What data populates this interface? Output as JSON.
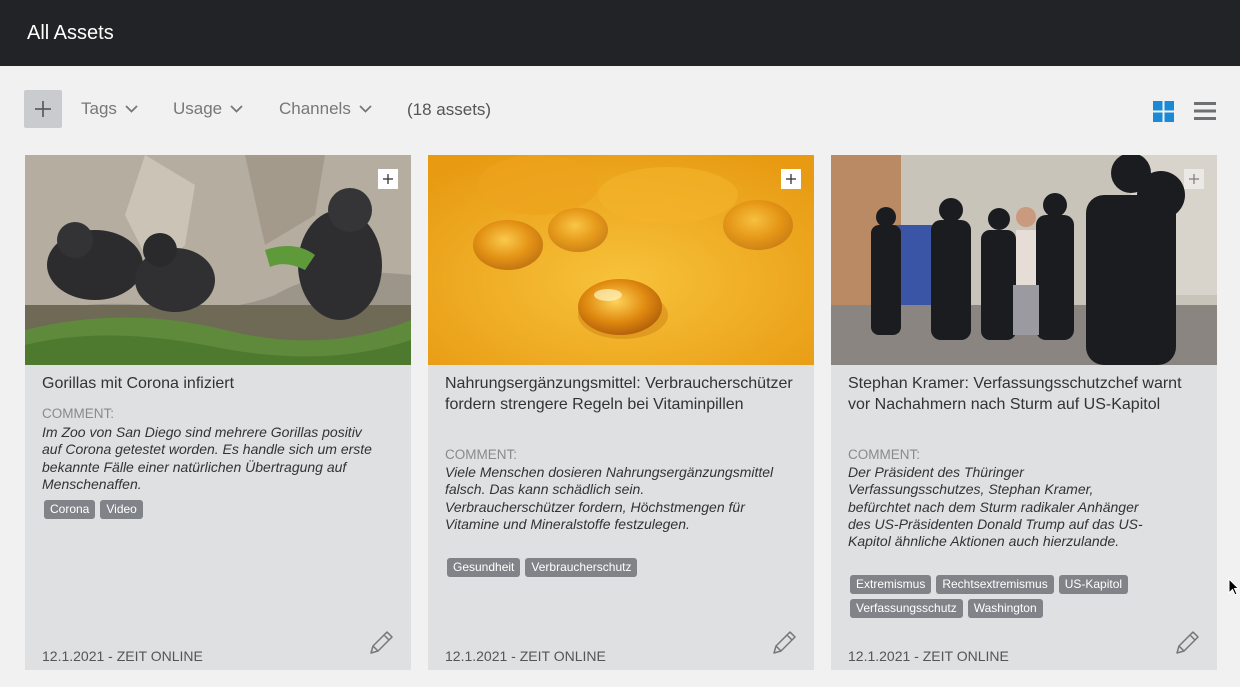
{
  "header": {
    "title": "All Assets"
  },
  "toolbar": {
    "add_icon": "plus-icon",
    "filters": [
      {
        "label": "Tags"
      },
      {
        "label": "Usage"
      },
      {
        "label": "Channels"
      }
    ],
    "asset_count": "(18 assets)",
    "view_grid_icon": "grid-view-icon",
    "view_list_icon": "list-view-icon",
    "accent_color": "#1b8ad6"
  },
  "cards": [
    {
      "headline": "Gorillas mit Corona infiziert",
      "comment_label": "COMMENT:",
      "comment": "Im Zoo von San Diego sind mehrere Gorillas positiv auf Corona getestet worden. Es handle sich um erste bekannte Fälle einer natürlichen Übertragung auf Menschenaffen.",
      "tags": [
        "Corona",
        "Video"
      ],
      "footer": "12.1.2021 - ZEIT ONLINE"
    },
    {
      "headline": "Nahrungsergänzungsmittel: Verbraucherschützer fordern strengere Regeln bei Vitaminpillen",
      "comment_label": "COMMENT:",
      "comment": "Viele Menschen dosieren Nahrungsergänzungsmittel falsch. Das kann schädlich sein. Verbraucherschützer fordern, Höchstmengen für Vitamine und Mineralstoffe festzulegen.",
      "tags": [
        "Gesundheit",
        "Verbraucherschutz"
      ],
      "footer": "12.1.2021 - ZEIT ONLINE"
    },
    {
      "headline": "Stephan Kramer: Verfassungsschutzchef warnt vor Nachahmern nach Sturm auf US-Kapitol",
      "comment_label": "COMMENT:",
      "comment": "Der Präsident des Thüringer Verfassungsschutzes, Stephan Kramer, befürchtet nach dem Sturm radikaler Anhänger des US-Präsidenten Donald Trump auf das US-Kapitol ähnliche Aktionen auch hierzulande.",
      "tags": [
        "Extremismus",
        "Rechtsextremismus",
        "US-Kapitol",
        "Verfassungsschutz",
        "Washington"
      ],
      "footer": "12.1.2021 - ZEIT ONLINE"
    }
  ]
}
